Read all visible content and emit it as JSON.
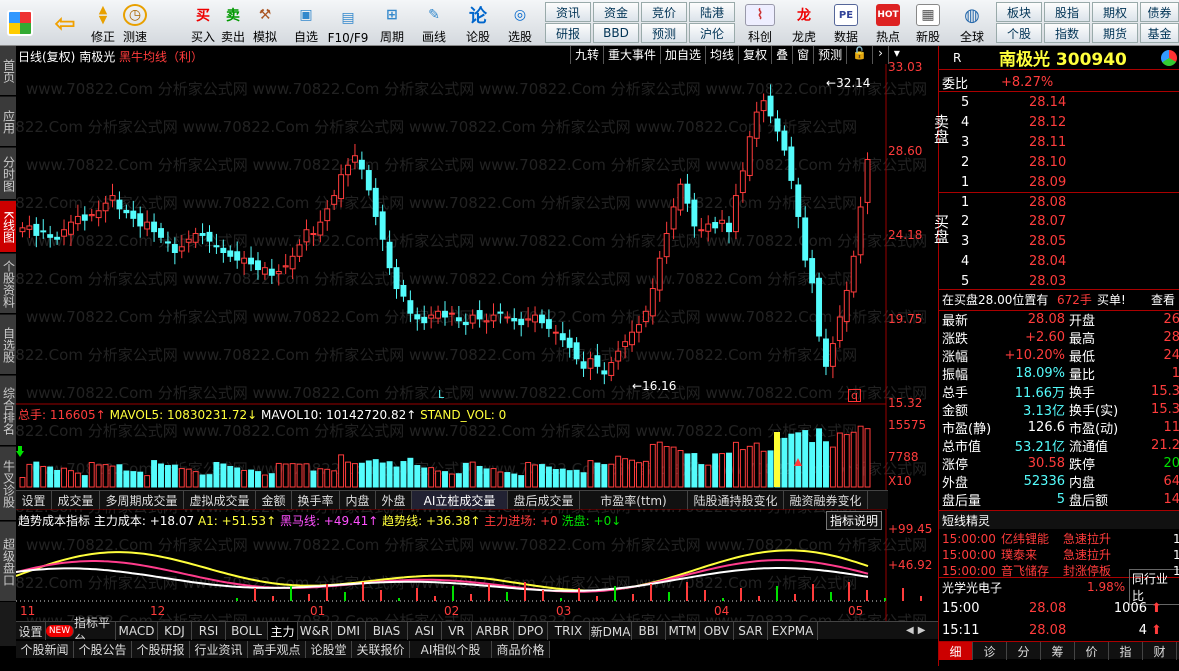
{
  "toolbar": {
    "buttons": [
      {
        "label": "",
        "icon": "windows-icon"
      },
      {
        "label": "",
        "icon": "back-icon"
      },
      {
        "label": "修正",
        "icon": "up-down-icon"
      },
      {
        "label": "测速",
        "icon": "clock-icon"
      },
      {
        "label": "买入",
        "icon": "buy-icon"
      },
      {
        "label": "卖出",
        "icon": "sell-icon"
      },
      {
        "label": "模拟",
        "icon": "hammer-icon"
      },
      {
        "label": "自选",
        "icon": "folder-icon"
      },
      {
        "label": "F10/F9",
        "icon": "doc-icon"
      },
      {
        "label": "周期",
        "icon": "period-icon"
      },
      {
        "label": "画线",
        "icon": "pen-icon"
      },
      {
        "label": "论股",
        "icon": "discuss-icon"
      },
      {
        "label": "选股",
        "icon": "pick-icon"
      }
    ],
    "small_buttons": [
      [
        "资讯",
        "研报"
      ],
      [
        "资金",
        "BBD"
      ],
      [
        "竞价",
        "预测"
      ],
      [
        "陆港",
        "沪伦"
      ]
    ],
    "right_buttons": [
      "科创",
      "龙虎",
      "数据",
      "热点",
      "新股"
    ],
    "globe": "全球",
    "right_small": [
      [
        "板块",
        "个股"
      ],
      [
        "股指",
        "指数"
      ],
      [
        "期权",
        "期货"
      ],
      [
        "债券",
        "基金"
      ]
    ]
  },
  "leftnav": [
    "首页",
    "应用",
    "分时图",
    "K线图",
    "个股资料",
    "自选股",
    "综合排名",
    "牛叉诊股",
    "超级盘口"
  ],
  "chart_header": {
    "period": "日线(复权)",
    "name": "南极光",
    "indicator": "黑牛均线（利）"
  },
  "chart_tools": [
    "九转",
    "重大事件",
    "加自选",
    "均线",
    "复权",
    "叠",
    "窗",
    "预测"
  ],
  "price_axis": [
    "33.03",
    "28.60",
    "24.18",
    "19.75",
    "15.32"
  ],
  "annotations": {
    "high": "32.14",
    "low": "16.16",
    "mark_l": "L",
    "mark_q": "q"
  },
  "watermark": "www.70822.Com 分析家公式网",
  "vol_header": {
    "total": "总手: 116605↑",
    "mavol5": "MAVOL5: 10830231.72↓",
    "mavol10": "MAVOL10: 10142720.82↑",
    "stand": "STAND_VOL: 0"
  },
  "vol_axis": [
    "15575",
    "7788",
    "X10"
  ],
  "mid_tabs": [
    "设置",
    "成交量",
    "多周期成交量",
    "虚拟成交量",
    "金额",
    "换手率",
    "内盘",
    "外盘",
    "AI立桩成交量",
    "盘后成交量",
    "市盈率(ttm)",
    "陆股通持股变化",
    "融资融券变化"
  ],
  "ind_header": {
    "name": "趋势成本指标",
    "main": "主力成本: +18.07",
    "a1": "A1: +51.53↑",
    "black": "黑马线: +49.41↑",
    "trend": "趋势线: +36.38↑",
    "enter": "主力进场: +0",
    "wash": "洗盘: +0↓",
    "explain": "指标说明"
  },
  "ind_axis": [
    "+99.45",
    "+46.92"
  ],
  "date_axis": [
    "11",
    "12",
    "01",
    "02",
    "03",
    "04",
    "05"
  ],
  "bottom_tabs": [
    "设置",
    "NEW",
    "指标平台",
    "MACD",
    "KDJ",
    "RSI",
    "BOLL",
    "主力",
    "W&R",
    "DMI",
    "BIAS",
    "ASI",
    "VR",
    "ARBR",
    "DPO",
    "TRIX",
    "新DMA",
    "BBI",
    "MTM",
    "OBV",
    "SAR",
    "EXPMA"
  ],
  "footer_tabs": [
    "个股新闻",
    "个股公告",
    "个股研报",
    "行业资讯",
    "高手观点",
    "论股堂",
    "关联报价",
    "AI相似个股",
    "商品价格"
  ],
  "quote": {
    "r": "R",
    "title": "南极光 300940",
    "wb_label": "委比",
    "wb": "+8.27%",
    "sell_label": "卖盘",
    "buy_label": "买盘",
    "asks": [
      [
        "5",
        "28.14"
      ],
      [
        "4",
        "28.12"
      ],
      [
        "3",
        "28.11"
      ],
      [
        "2",
        "28.10"
      ],
      [
        "1",
        "28.09"
      ]
    ],
    "bids": [
      [
        "1",
        "28.08"
      ],
      [
        "2",
        "28.07"
      ],
      [
        "3",
        "28.05"
      ],
      [
        "4",
        "28.04"
      ],
      [
        "5",
        "28.03"
      ]
    ],
    "notice": "在买盘28.00位置有",
    "notice_qty": "672手",
    "notice_act": "买单!",
    "notice_view": "查看",
    "stats": [
      [
        "最新",
        "28.08",
        "开盘",
        "26"
      ],
      [
        "涨跌",
        "+2.60",
        "最高",
        "28"
      ],
      [
        "涨幅",
        "+10.20%",
        "最低",
        "24"
      ],
      [
        "振幅",
        "18.09%",
        "量比",
        "1"
      ],
      [
        "总手",
        "11.66万",
        "换手",
        "15.3"
      ],
      [
        "金额",
        "3.13亿",
        "换手(实)",
        "15.3"
      ],
      [
        "市盈(静)",
        "126.6",
        "市盈(动)",
        "11"
      ],
      [
        "总市值",
        "53.21亿",
        "流通值",
        "21.2"
      ],
      [
        "涨停",
        "30.58",
        "跌停",
        "20"
      ],
      [
        "外盘",
        "52336",
        "内盘",
        "64"
      ],
      [
        "盘后量",
        "5",
        "盘后额",
        "14"
      ]
    ],
    "spirit_title": "短线精灵",
    "spirit": [
      [
        "15:00:00",
        "亿纬锂能",
        "急速拉升",
        "1"
      ],
      [
        "15:00:00",
        "璞泰来",
        "急速拉升",
        "1"
      ],
      [
        "15:00:00",
        "音飞储存",
        "封涨停板",
        "1"
      ]
    ],
    "sector": "光学光电子",
    "sector_pct": "1.98%",
    "sector_comp": "同行业比",
    "ticks": [
      [
        "15:00",
        "28.08",
        "1006"
      ],
      [
        "15:11",
        "28.08",
        "4"
      ]
    ],
    "tabs": [
      "细",
      "诊",
      "分",
      "筹",
      "价",
      "指",
      "财"
    ]
  }
}
